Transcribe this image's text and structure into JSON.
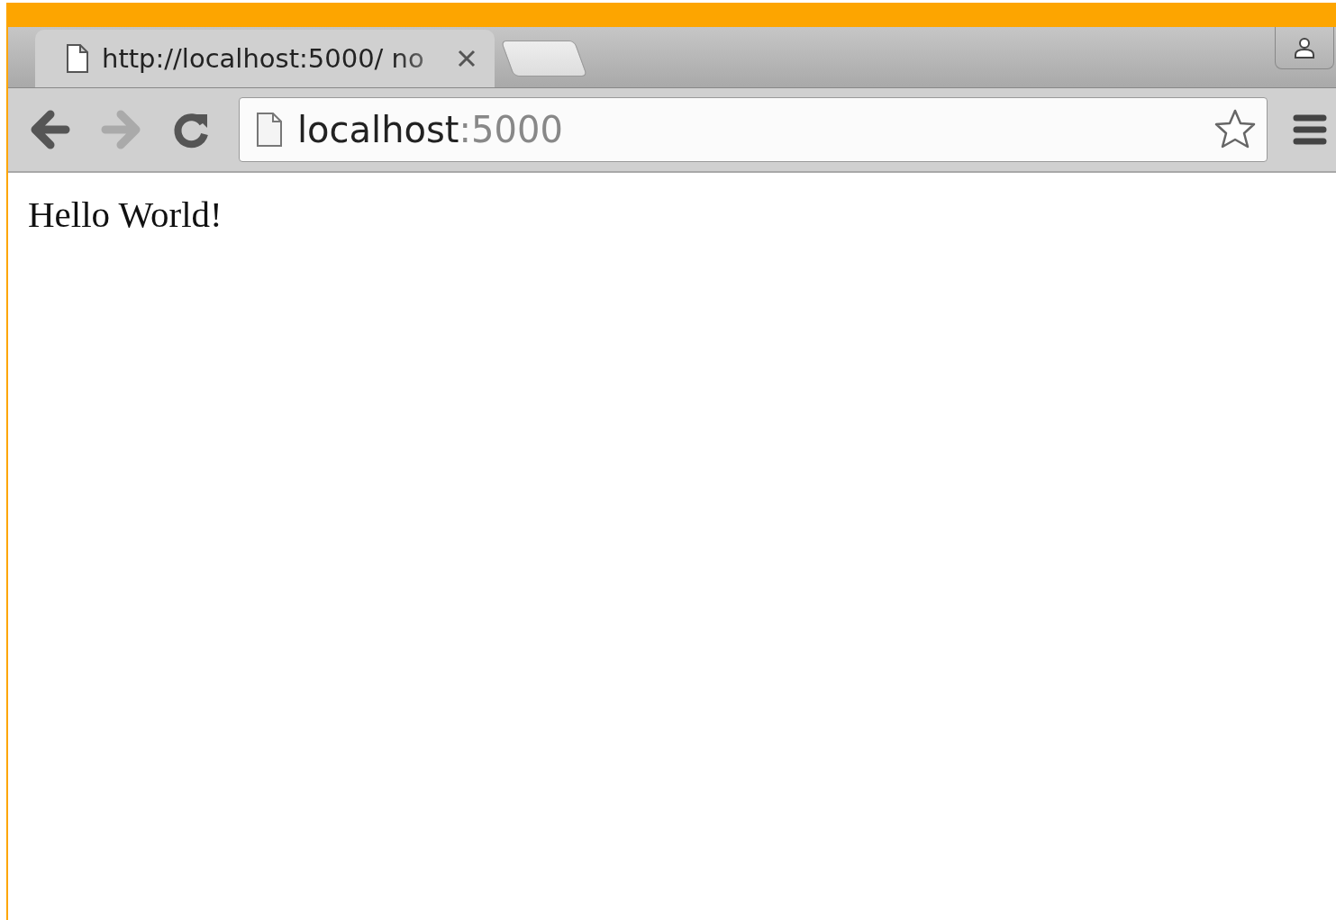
{
  "tabs": [
    {
      "title": "http://localhost:5000/ no",
      "selected": true,
      "kind": "page"
    },
    {
      "kind": "new"
    }
  ],
  "toolbar": {
    "back_disabled": false,
    "forward_disabled": true
  },
  "address": {
    "host": "localhost",
    "port": ":5000",
    "bookmarked": false
  },
  "page": {
    "text": "Hello World!"
  }
}
